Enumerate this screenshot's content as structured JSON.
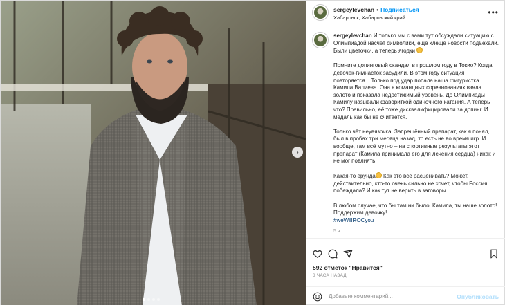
{
  "header": {
    "username": "sergeylevchan",
    "separator": "•",
    "follow_label": "Подписаться",
    "location": "Хабаровск, Хабаровский край",
    "more_label": "•••"
  },
  "caption": {
    "username": "sergeylevchan",
    "p1": " И только мы с вами тут обсуждали ситуацию с Олимпиадой насчёт символики, ещё хлеще новости подъехали. Были цветочки, а теперь ягодки",
    "p2": "Помните допинговый скандал в прошлом году в Токио? Когда девочек-гимнасток засудили. В этом году ситуация повторяется... Только под удар попала наша фигуристка Камила Валиева. Она в командных соревнованиях взяла золото и показала недостижимый уровень. До Олимпиады Камилу называли фавориткой одиночного катания. А теперь что? Правильно, её тоже дисквалифицировали за допинг. И медаль как бы не считается.",
    "p3": "Только чёт неувязочка. Запрещённый препарат, как я понял, был в пробах три месяца назад, то есть не во время игр. И вообще, там всё мутно – на спортивные результаты этот препарат (Камила принимала его для лечения сердца) никак и не мог повлиять.",
    "p4a": "Какая-то ерунда",
    "p4b": " Как это всё расценивать? Может, действительно, кто-то очень сильно не хочет, чтобы Россия побеждала? И как тут не верить в заговоры.",
    "p5": "В любом случае, что бы там ни было, Камила, ты наше золото! Поддержим девочку!",
    "hashtag": "#weWillROCyou",
    "time": "5 ч."
  },
  "stats": {
    "likes": "592 отметок \"Нравится\"",
    "ago": "3 ЧАСА НАЗАД"
  },
  "comment": {
    "placeholder": "Добавьте комментарий...",
    "publish_label": "Опубликовать"
  },
  "carousel": {
    "next_glyph": "›",
    "slide_count": 4,
    "active_index": 0
  },
  "colors": {
    "accent": "#0095f6",
    "hashtag": "#00376b",
    "publish_disabled": "#b2dffc",
    "muted": "#8e8e8e"
  },
  "icons": [
    "heart-icon",
    "comment-icon",
    "share-icon",
    "bookmark-icon",
    "emoji-icon",
    "chevron-right-icon"
  ]
}
